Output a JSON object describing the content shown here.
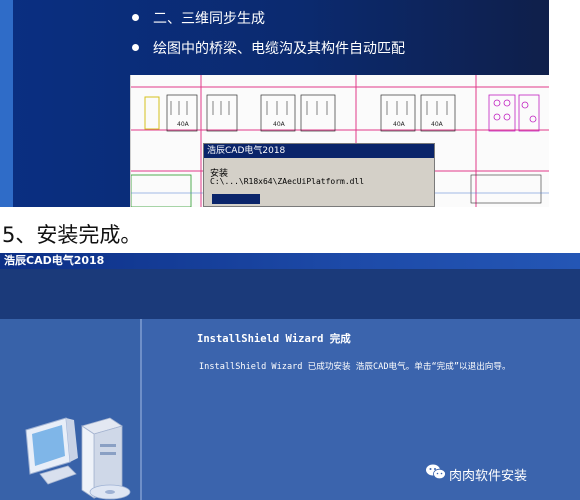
{
  "slide": {
    "bullets": [
      "二、三维同步生成",
      "绘图中的桥梁、电缆沟及其构件自动匹配"
    ],
    "cad_labels": [
      "40A",
      "40A",
      "40A",
      "40A"
    ],
    "mini_dialog": {
      "title": "浩辰CAD电气2018",
      "line1": "安装",
      "line2": "C:\\...\\R18x64\\ZAecUiPlatform.dll"
    }
  },
  "heading": "5、安装完成。",
  "installer": {
    "window_title": "浩辰CAD电气2018",
    "wizard_title": "InstallShield Wizard 完成",
    "wizard_message": "InstallShield Wizard 已成功安装 浩辰CAD电气。单击“完成”以退出向导。"
  },
  "watermark": {
    "text": "肉肉软件安装",
    "icon": "wechat-icon"
  },
  "colors": {
    "slide_bg": "#0b2a6f",
    "titlebar": "#0c2f86",
    "wizard_bg": "#3b63ac"
  }
}
